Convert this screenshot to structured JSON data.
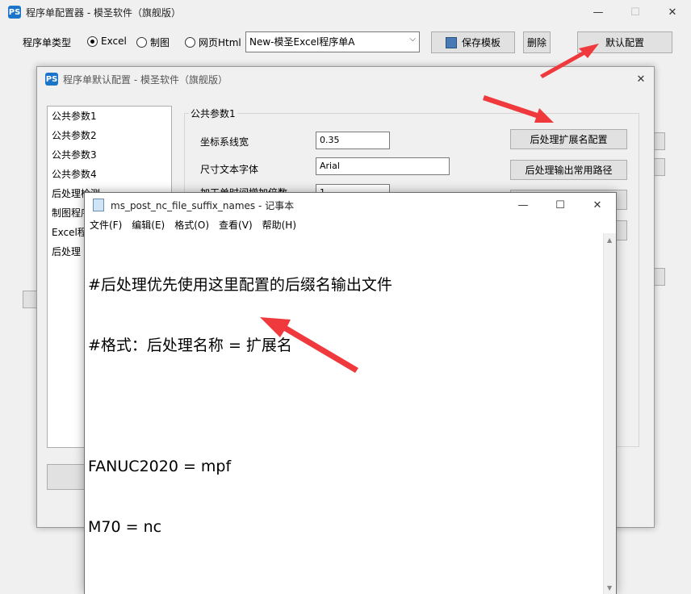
{
  "main_window": {
    "title": "程序单配置器 - 模圣软件（旗舰版）",
    "app_icon_text": "PS",
    "window_controls": {
      "minimize": "—",
      "maximize": "☐",
      "close": "✕"
    },
    "toolbar": {
      "type_label": "程序单类型",
      "radio_options": [
        {
          "label": "Excel",
          "selected": true
        },
        {
          "label": "制图",
          "selected": false
        },
        {
          "label": "网页Html",
          "selected": false
        }
      ],
      "template_select": "New-模圣Excel程序单A",
      "save_template_button": "保存模板",
      "delete_button": "删除",
      "default_config_button": "默认配置"
    }
  },
  "dialog": {
    "title": "程序单默认配置 - 模圣软件（旗舰版）",
    "close": "✕",
    "list_items": [
      "公共参数1",
      "公共参数2",
      "公共参数3",
      "公共参数4",
      "后处理检测",
      "制图程序",
      "Excel程序",
      "后处理"
    ],
    "group_title": "公共参数1",
    "fields": [
      {
        "label": "坐标系线宽",
        "value": "0.35"
      },
      {
        "label": "尺寸文本字体",
        "value": "Arial"
      },
      {
        "label": "加工单时间增加倍数",
        "value": "1"
      }
    ],
    "buttons": {
      "suffix_config": "后处理扩展名配置",
      "output_path": "后处理输出常用路径"
    }
  },
  "notepad": {
    "title": "ms_post_nc_file_suffix_names - 记事本",
    "window_controls": {
      "minimize": "—",
      "maximize": "☐",
      "close": "✕"
    },
    "menu": [
      "文件(F)",
      "编辑(E)",
      "格式(O)",
      "查看(V)",
      "帮助(H)"
    ],
    "lines": [
      "#后处理优先使用这里配置的后缀名输出文件",
      "#格式：后处理名称 = 扩展名",
      "",
      "FANUC2020 = mpf",
      "M70 = nc"
    ]
  },
  "annotation_color": "#f0393c"
}
